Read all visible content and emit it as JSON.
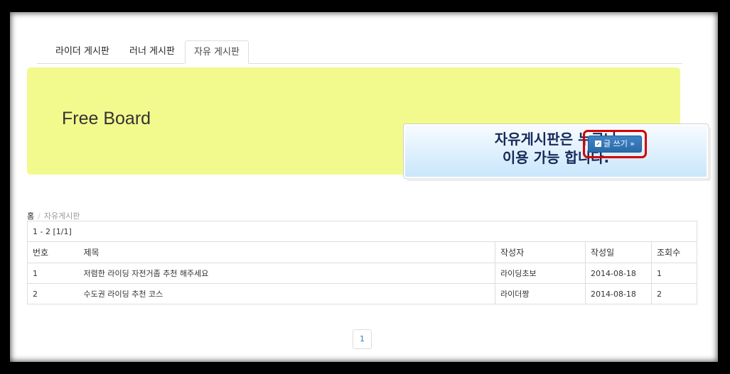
{
  "tabs": [
    {
      "label": "라이더 게시판"
    },
    {
      "label": "러너 게시판"
    },
    {
      "label": "자유 게시판"
    }
  ],
  "jumbotron": {
    "title": "Free Board",
    "callout_line1": "자유게시판은 누구나",
    "callout_line2": "이용 가능 합니다.",
    "write_button_label": "글 쓰기 »"
  },
  "breadcrumb": {
    "home": "홈",
    "separator": "/",
    "current": "자유게시판"
  },
  "board": {
    "count_text": "1 - 2 [1/1]",
    "headers": {
      "no": "번호",
      "title": "제목",
      "writer": "작성자",
      "date": "작성일",
      "views": "조회수"
    },
    "rows": [
      {
        "no": "1",
        "title": "저렴한 라이딩 자전거좀 추천 해주세요",
        "writer": "라이딩초보",
        "date": "2014-08-18",
        "views": "1"
      },
      {
        "no": "2",
        "title": "수도권 라이딩 추천 코스",
        "writer": "라이더짱",
        "date": "2014-08-18",
        "views": "2"
      }
    ]
  },
  "pagination": {
    "current_page": "1"
  },
  "colors": {
    "jumbotron_bg": "#f3fa8d",
    "button_blue": "#2b6aa8",
    "highlight_red": "#d40000",
    "link_blue": "#337ab7"
  }
}
